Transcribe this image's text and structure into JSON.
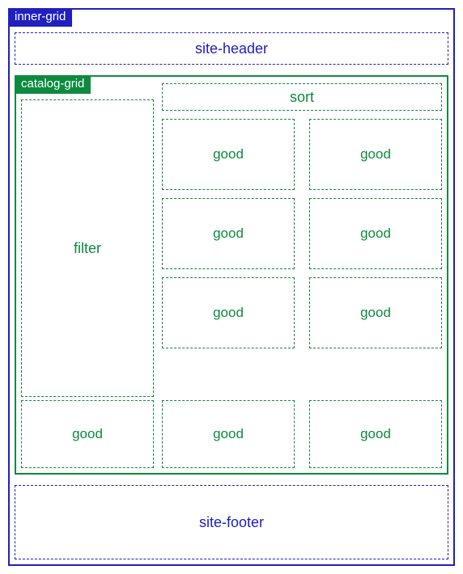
{
  "outer": {
    "tag": "inner-grid",
    "header": "site-header",
    "footer": "site-footer"
  },
  "catalog": {
    "tag": "catalog-grid",
    "filter": "filter",
    "sort": "sort",
    "goods": {
      "r1c1": "good",
      "r1c2": "good",
      "r2c1": "good",
      "r2c2": "good",
      "r3c1": "good",
      "r3c2": "good",
      "r4c0": "good",
      "r4c1": "good",
      "r4c2": "good"
    }
  }
}
